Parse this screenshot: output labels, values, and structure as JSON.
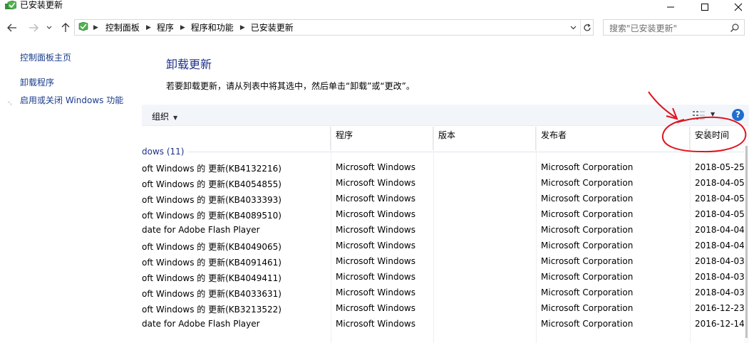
{
  "window": {
    "title": "已安装更新",
    "icon": "programs-features-icon",
    "controls": [
      "minimize-icon",
      "maximize-icon",
      "close-icon"
    ]
  },
  "nav": {
    "breadcrumbs": [
      "控制面板",
      "程序",
      "程序和功能",
      "已安装更新"
    ],
    "search_placeholder": "搜索\"已安装更新\""
  },
  "left_pane": {
    "home": "控制面板主页",
    "uninstall": "卸载程序",
    "features": "启用或关闭 Windows 功能"
  },
  "main": {
    "title": "卸载更新",
    "description": "若要卸载更新，请从列表中将其选中，然后单击“卸载”或“更改”。",
    "toolbar": {
      "organize": "组织"
    }
  },
  "list": {
    "columns": [
      "",
      "程序",
      "版本",
      "发布者",
      "安装时间"
    ],
    "group_label": "dows (11)",
    "rows": [
      {
        "name": "oft Windows 的 更新(KB4132216)",
        "program": "Microsoft Windows",
        "version": "",
        "publisher": "Microsoft Corporation",
        "date": "2018-05-25"
      },
      {
        "name": "oft Windows 的 更新(KB4054855)",
        "program": "Microsoft Windows",
        "version": "",
        "publisher": "Microsoft Corporation",
        "date": "2018-04-05"
      },
      {
        "name": "oft Windows 的 更新(KB4033393)",
        "program": "Microsoft Windows",
        "version": "",
        "publisher": "Microsoft Corporation",
        "date": "2018-04-05"
      },
      {
        "name": "oft Windows 的 更新(KB4089510)",
        "program": "Microsoft Windows",
        "version": "",
        "publisher": "Microsoft Corporation",
        "date": "2018-04-05"
      },
      {
        "name": "date for Adobe Flash Player",
        "program": "Microsoft Windows",
        "version": "",
        "publisher": "Microsoft Corporation",
        "date": "2018-04-04"
      },
      {
        "name": "oft Windows 的 更新(KB4049065)",
        "program": "Microsoft Windows",
        "version": "",
        "publisher": "Microsoft Corporation",
        "date": "2018-04-04"
      },
      {
        "name": "oft Windows 的 更新(KB4091461)",
        "program": "Microsoft Windows",
        "version": "",
        "publisher": "Microsoft Corporation",
        "date": "2018-04-03"
      },
      {
        "name": "oft Windows 的 更新(KB4049411)",
        "program": "Microsoft Windows",
        "version": "",
        "publisher": "Microsoft Corporation",
        "date": "2018-04-03"
      },
      {
        "name": "oft Windows 的 更新(KB4033631)",
        "program": "Microsoft Windows",
        "version": "",
        "publisher": "Microsoft Corporation",
        "date": "2018-04-03"
      },
      {
        "name": "oft Windows 的 更新(KB3213522)",
        "program": "Microsoft Windows",
        "version": "",
        "publisher": "Microsoft Corporation",
        "date": "2016-12-23"
      },
      {
        "name": "date for Adobe Flash Player",
        "program": "Microsoft Windows",
        "version": "",
        "publisher": "Microsoft Corporation",
        "date": "2016-12-14"
      }
    ]
  },
  "colors": {
    "link": "#1a3c8c",
    "heading": "#1e3287",
    "toolbar_bg": "#f2f6fb",
    "annotation": "#e0141e"
  }
}
